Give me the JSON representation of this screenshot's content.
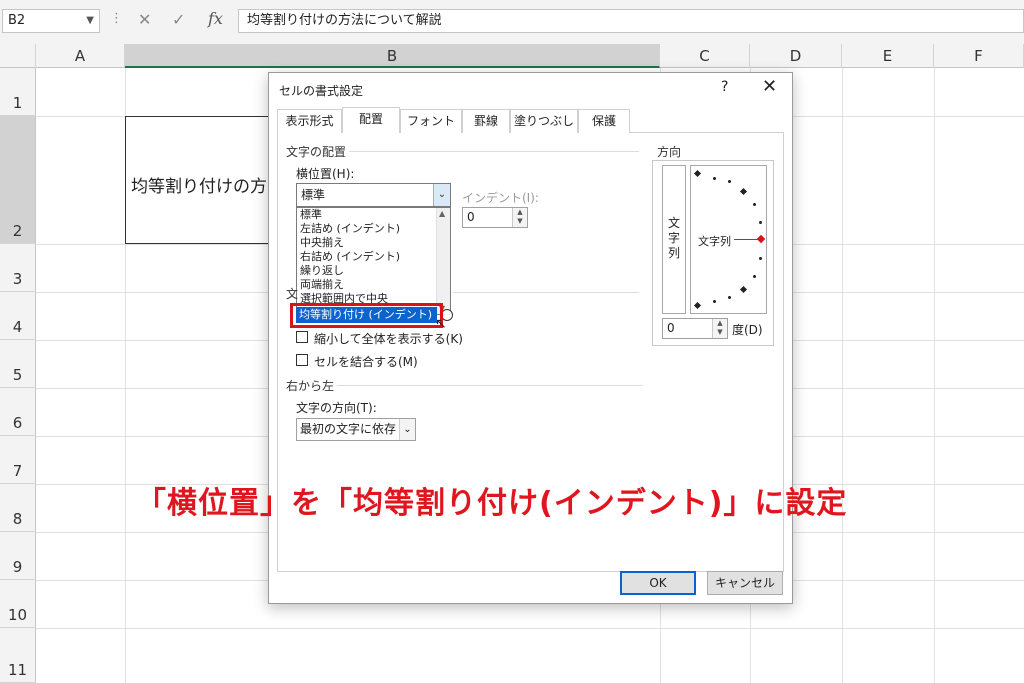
{
  "formula_bar": {
    "name_box": "B2",
    "fx_label": "fx",
    "content": "均等割り付けの方法について解説"
  },
  "columns": [
    "A",
    "B",
    "C",
    "D",
    "E",
    "F"
  ],
  "rows": [
    "1",
    "2",
    "3",
    "4",
    "5",
    "6",
    "7",
    "8",
    "9",
    "10",
    "11"
  ],
  "selected_column": "B",
  "selected_row": "2",
  "cell_b2_visible_text": "均等割り付けの方",
  "dialog": {
    "title": "セルの書式設定",
    "help": "?",
    "close": "✕",
    "tabs": [
      "表示形式",
      "配置",
      "フォント",
      "罫線",
      "塗りつぶし",
      "保護"
    ],
    "active_tab": "配置",
    "alignment_section": "文字の配置",
    "horizontal_label": "横位置(H):",
    "horizontal_value": "標準",
    "indent_label": "インデント(I):",
    "indent_value": "0",
    "horizontal_options": [
      "標準",
      "左詰め (インデント)",
      "中央揃え",
      "右詰め (インデント)",
      "繰り返し",
      "両端揃え",
      "選択範囲内で中央"
    ],
    "highlighted_option": "均等割り付け (インデント)",
    "control_section_fragment": "文",
    "shrink_label": "縮小して全体を表示する(K)",
    "merge_label": "セルを結合する(M)",
    "rtl_section": "右から左",
    "text_direction_label": "文字の方向(T):",
    "text_direction_value": "最初の文字に依存",
    "orientation_section": "方向",
    "vertical_text": "文字列",
    "dial_label": "文字列",
    "degrees_value": "0",
    "degrees_label": "度(D)",
    "ok_button": "OK",
    "cancel_button": "キャンセル"
  },
  "instruction": "「横位置」を「均等割り付け(インデント)」に設定",
  "colors": {
    "highlight": "#0a64d0",
    "instruction_red": "#e0161e",
    "callout_red": "#d9121c"
  }
}
